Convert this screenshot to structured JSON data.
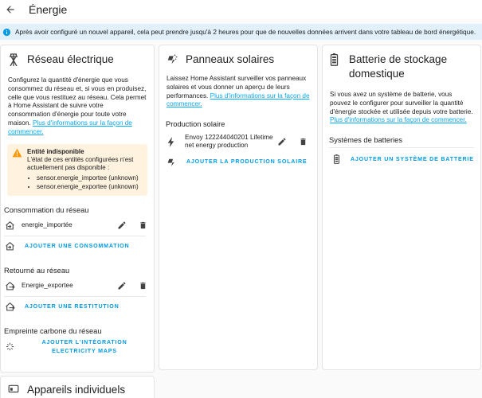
{
  "header": {
    "title": "Énergie"
  },
  "banner": {
    "text": "Après avoir configuré un nouvel appareil, cela peut prendre jusqu'à 2 heures pour que de nouvelles données arrivent dans votre tableau de bord énergétique."
  },
  "grid": {
    "title": "Réseau électrique",
    "description": "Configurez la quantité d'énergie que vous consommez du réseau et, si vous en produisez, celle que vous restituez au réseau. Cela permet à Home Assistant de suivre votre consommation d'énergie pour toute votre maison.",
    "link": "Plus d'informations sur la façon de commencer.",
    "warning": {
      "title": "Entité indisponible",
      "text": "L'état de ces entités configurées n'est actuellement pas disponible :",
      "items": [
        "sensor.energie_importee (unknown)",
        "sensor.energie_exportee (unknown)"
      ]
    },
    "consumption": {
      "title": "Consommation du réseau",
      "entity": "energie_importée",
      "add": "Ajouter une consommation"
    },
    "return": {
      "title": "Retourné au réseau",
      "entity": "Energie_exportee",
      "add": "Ajouter une restitution"
    },
    "carbon": {
      "title": "Empreinte carbone du réseau",
      "add": "Ajouter l'intégration Electricity Maps"
    }
  },
  "solar": {
    "title": "Panneaux solaires",
    "description": "Laissez Home Assistant surveiller vos panneaux solaires et vous donner un aperçu de leurs performances.",
    "link": "Plus d'informations sur la façon de commencer.",
    "production_title": "Production solaire",
    "entity": "Envoy 122244040201 Lifetime net energy production",
    "add": "Ajouter la production solaire"
  },
  "battery": {
    "title": "Batterie de stockage domestique",
    "description": "Si vous avez un système de batterie, vous pouvez le configurer pour surveiller la quantité d'énergie stockée et utilisée depuis votre batterie.",
    "link": "Plus d'informations sur la façon de commencer.",
    "systems_title": "Systèmes de batteries",
    "add": "Ajouter un système de batterie"
  },
  "devices": {
    "title": "Appareils individuels"
  },
  "colors": {
    "accent": "#03a9f4",
    "banner": "#e1f0fa",
    "warning": "#fff3e0",
    "warning_icon": "#ff9800"
  }
}
